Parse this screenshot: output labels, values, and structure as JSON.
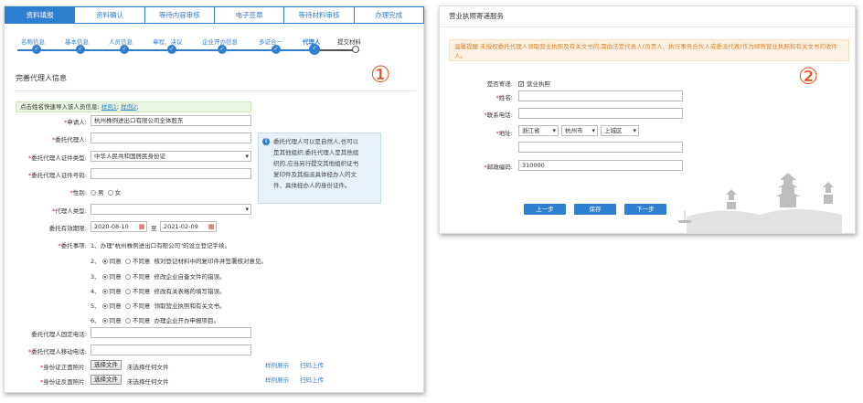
{
  "panel1": {
    "steps": [
      "资料填报",
      "资料确认",
      "等待内容审核",
      "电子签章",
      "等待材料审核",
      "办理完成"
    ],
    "substeps": [
      "名称信息",
      "基本信息",
      "人员信息",
      "章程、决议",
      "企业开办信息",
      "多证合一",
      "代理人",
      "提交材料"
    ],
    "marker": "①",
    "section_title": "完善代理人信息",
    "quick": {
      "prefix": "点击姓名快速导入该人员信息:",
      "ex1": "样例1",
      "ex2": "样例2"
    },
    "fields": {
      "applicant_label": "申请人:",
      "applicant_value": "杭州株例进出口有限公司全体股东",
      "agent_label": "委托代理人:",
      "idtype_label": "委托代理人证件类型:",
      "idtype_value": "中华人民共和国居民身份证",
      "idno_label": "委托代理人证件号码:",
      "gender_label": "性别:",
      "male": "男",
      "female": "女",
      "agent_type_label": "代理人类型:",
      "validity_label": "委托有效期限:",
      "date_from": "2020-08-10",
      "date_to_sep": "至",
      "date_to": "2021-02-09",
      "matters_label": "委托事项:",
      "matter1": "1、办理\"杭州株例进出口有限公司\"的设立登记手续。",
      "fixed_phone_label": "委托代理人固定电话:",
      "mobile_label": "委托代理人移动电话:",
      "id_front_label": "身份证正面照片:",
      "id_back_label": "身份证反面照片:",
      "choose_file": "选择文件",
      "no_file": "未选择任何文件",
      "sample_link": "样例展示",
      "scan_link": "扫码上传"
    },
    "matters": [
      {
        "no": "2、",
        "agree": "同意",
        "disagree": "不同意",
        "text": "核对登记材料中的复印件并签署核对意见。"
      },
      {
        "no": "3、",
        "agree": "同意",
        "disagree": "不同意",
        "text": "修改企业自备文件的错误。"
      },
      {
        "no": "4、",
        "agree": "同意",
        "disagree": "不同意",
        "text": "修改有关表格的填写错误。"
      },
      {
        "no": "5、",
        "agree": "同意",
        "disagree": "不同意",
        "text": "领取营业执照和有关文书。"
      },
      {
        "no": "6、",
        "agree": "同意",
        "disagree": "不同意",
        "text": "办理企业开办申报项目。"
      }
    ],
    "info_lines": [
      "委托代理人可以是自然人,也可以",
      "是其他组织;委托代理人是其他组",
      "织的,应当另行提交其他组织证书",
      "复印件及其指派具体经办人的文",
      "件、具体经办人的身份证件。"
    ]
  },
  "panel2": {
    "title": "营业执照寄递服务",
    "marker": "②",
    "notice": "温馨提醒:未授权委托代理人领取营业执照及有关文书的,需由法定代表人(负责人、执行事务合伙人或委派代表)作为邮寄营业执照和有关文书的收件人。",
    "mail_label": "是否寄递:",
    "mail_option": "营业执照",
    "name_label": "姓名:",
    "phone_label": "联系电话:",
    "address_label": "地址:",
    "province": "浙江省",
    "city": "杭州市",
    "district": "上城区",
    "zip_label": "邮政编码:",
    "zip_value": "310000",
    "btn_prev": "上一步",
    "btn_save": "保存",
    "btn_next": "下一步"
  },
  "colors": {
    "accent": "#2f7fd1",
    "marker": "#e74c1a",
    "required": "#e02020"
  }
}
